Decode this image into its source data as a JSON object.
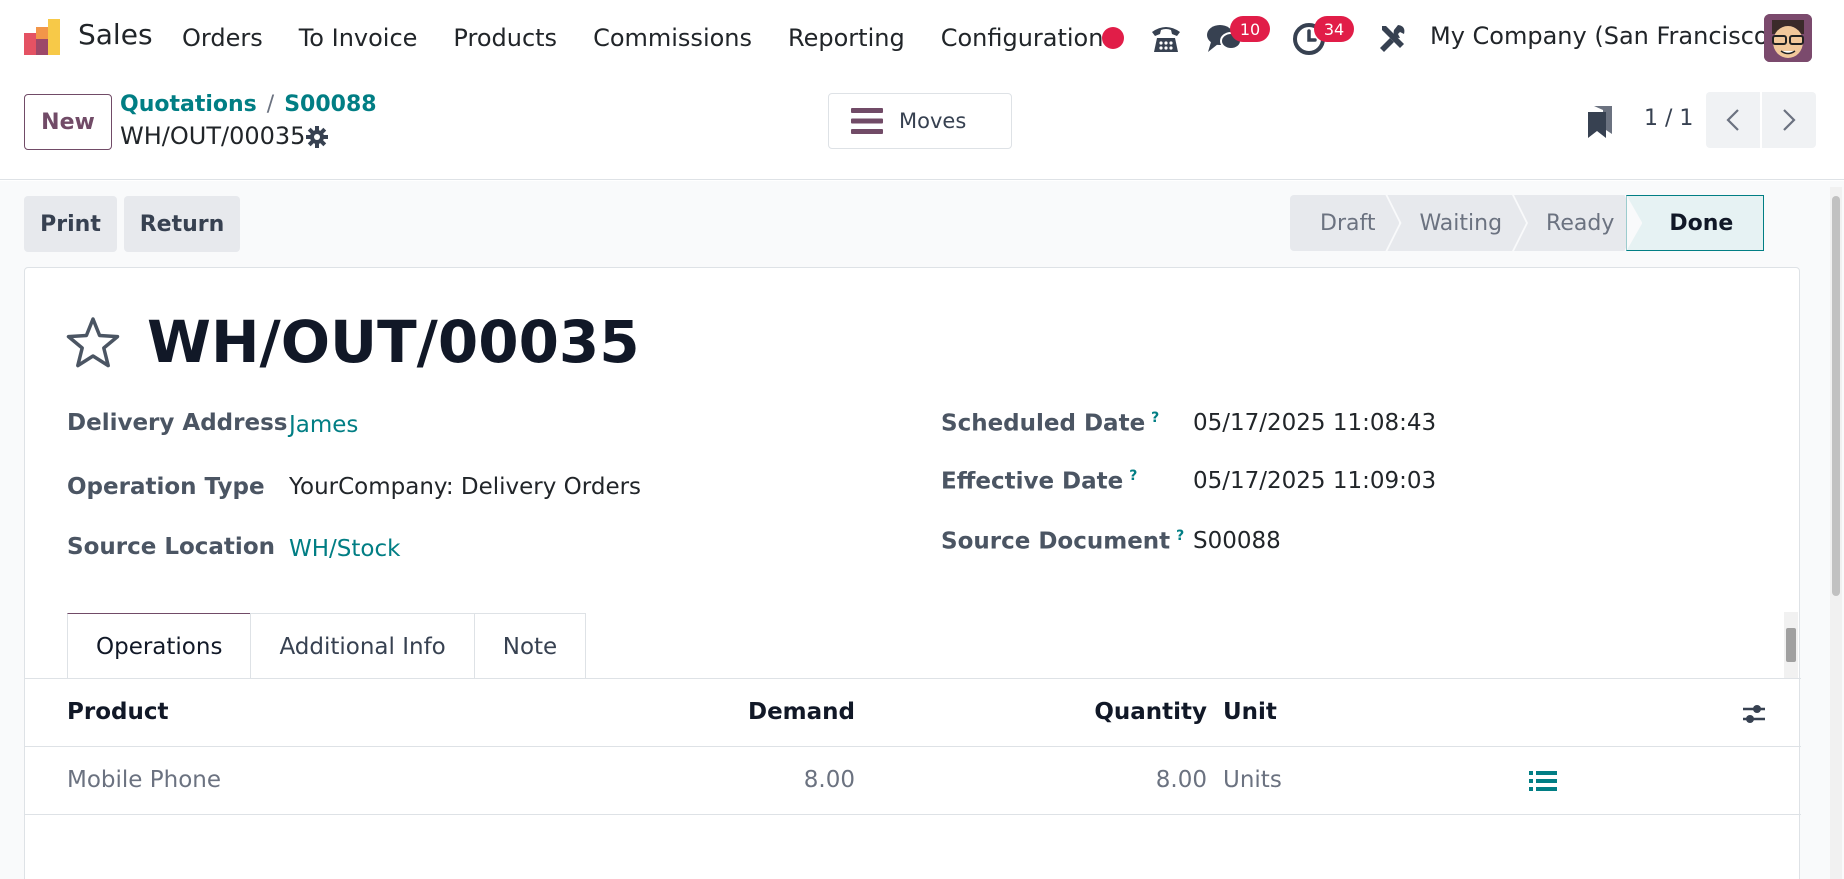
{
  "app": {
    "name": "Sales"
  },
  "menu": [
    "Orders",
    "To Invoice",
    "Products",
    "Commissions",
    "Reporting",
    "Configuration"
  ],
  "systray": {
    "messages_count": "10",
    "activities_count": "34",
    "company": "My Company (San Francisco)"
  },
  "control": {
    "new_label": "New",
    "breadcrumb": [
      "Quotations",
      "S00088"
    ],
    "breadcrumb_sep": "/",
    "record": "WH/OUT/00035",
    "moves_label": "Moves",
    "pager": "1 / 1"
  },
  "actions": {
    "print": "Print",
    "return": "Return"
  },
  "status": {
    "stages": [
      "Draft",
      "Waiting",
      "Ready",
      "Done"
    ],
    "current": "Done"
  },
  "form": {
    "title": "WH/OUT/00035",
    "left": [
      {
        "label": "Delivery Address",
        "value": "James"
      },
      {
        "label": "Operation Type",
        "value": "YourCompany: Delivery Orders"
      },
      {
        "label": "Source Location",
        "value": "WH/Stock"
      }
    ],
    "right": [
      {
        "label": "Scheduled Date",
        "help": "?",
        "value": "05/17/2025 11:08:43"
      },
      {
        "label": "Effective Date",
        "help": "?",
        "value": "05/17/2025 11:09:03"
      },
      {
        "label": "Source Document",
        "help": "?",
        "value": "S00088"
      }
    ]
  },
  "tabs": [
    "Operations",
    "Additional Info",
    "Note"
  ],
  "table": {
    "columns": [
      "Product",
      "Demand",
      "Quantity",
      "Unit"
    ],
    "rows": [
      {
        "product": "Mobile Phone",
        "demand": "8.00",
        "quantity": "8.00",
        "unit": "Units"
      }
    ]
  },
  "colors": {
    "brand": "#714b67",
    "link": "#017e84",
    "badge": "#e11d48"
  }
}
